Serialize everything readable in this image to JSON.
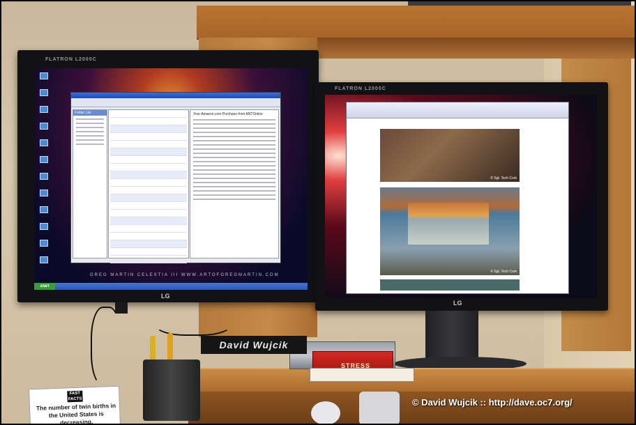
{
  "photo": {
    "nameplate": "David Wujcik",
    "watermark": "© David Wujcik :: http://dave.oc7.org/",
    "book_title": "STRESS",
    "card_text": "The number of twin births in the United States is decreasing.",
    "card_logo": "FAST FACTS"
  },
  "monitors": {
    "left_brand": "FLATRON L2000C",
    "left_logo": "LG",
    "right_brand": "FLATRON L2000C",
    "right_logo": "LG",
    "wallpaper_caption": "GREG MARTIN   CELESTIA III   WWW.ARTOFGREGMARTIN.COM",
    "start_label": "start",
    "folder_list_label": "Folder List",
    "reading_pane_subject": "Your Amazon.com Purchase from ANTOnline",
    "photo_credit": "© Sgt. Tech Cork"
  }
}
